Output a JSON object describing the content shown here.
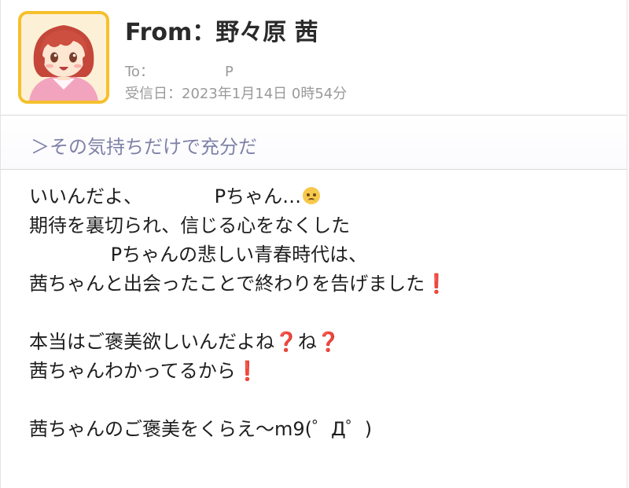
{
  "header": {
    "from_text": "From：野々原 茜",
    "to_label": "To：",
    "to_value": "P",
    "date_text": "受信日：2023年1月14日 0時54分",
    "avatar_icon": "character-avatar-icon",
    "frame_color": "#f6c02b"
  },
  "subject": {
    "text": "＞その気持ちだけで充分だ",
    "color": "#7f82a8"
  },
  "body": {
    "line1_text": "いいんだよ、　　　　 Pちゃん…",
    "line1_emoji": "sweat-face-icon",
    "line2_text": "期待を裏切られ、信じる心をなくした",
    "line3_text": "　　　　 Pちゃんの悲しい青春時代は、",
    "line4_text": "茜ちゃんと出会ったことで終わりを告げました",
    "line4_mark": "❗",
    "line5_text": "本当はご褒美欲しいんだよね",
    "line5_mark1": "❓",
    "line5_mid": "ね",
    "line5_mark2": "❓",
    "line6_text": "茜ちゃんわかってるから",
    "line6_mark": "❗",
    "line7_text": "茜ちゃんのご褒美をくらえ〜m9(゜Д゜)"
  }
}
